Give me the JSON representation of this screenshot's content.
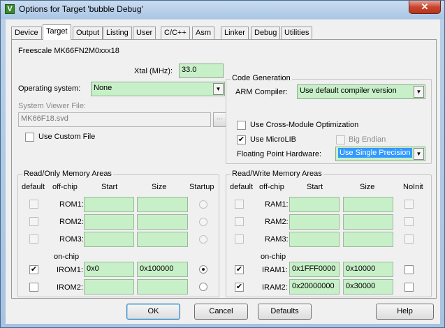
{
  "window": {
    "title": "Options for Target 'bubble Debug'",
    "icon_letter": "V",
    "close_glyph": "✕"
  },
  "tabs": [
    {
      "label": "Device"
    },
    {
      "label": "Target"
    },
    {
      "label": "Output"
    },
    {
      "label": "Listing"
    },
    {
      "label": "User"
    },
    {
      "label": "C/C++"
    },
    {
      "label": "Asm"
    },
    {
      "label": "Linker"
    },
    {
      "label": "Debug"
    },
    {
      "label": "Utilities"
    }
  ],
  "active_tab": "Target",
  "device_name": "Freescale MK66FN2M0xxx18",
  "xtal": {
    "label": "Xtal (MHz):",
    "value": "33.0"
  },
  "os": {
    "label": "Operating system:",
    "value": "None"
  },
  "svd": {
    "label": "System Viewer File:",
    "value": "MK66F18.svd",
    "browse_label": "...",
    "custom_label": "Use Custom File",
    "custom_checked": false
  },
  "code_gen": {
    "title": "Code Generation",
    "compiler_label": "ARM Compiler:",
    "compiler_value": "Use default compiler version",
    "cross_module_label": "Use Cross-Module Optimization",
    "cross_module_checked": false,
    "microlib_label": "Use MicroLIB",
    "microlib_checked": true,
    "big_endian_label": "Big Endian",
    "big_endian_checked": false,
    "fph_label": "Floating Point Hardware:",
    "fph_value": "Use Single Precision"
  },
  "ro_memory": {
    "title": "Read/Only Memory Areas",
    "headers": {
      "default": "default",
      "offchip": "off-chip",
      "start": "Start",
      "size": "Size",
      "startup": "Startup"
    },
    "onchip_label": "on-chip",
    "rows": [
      {
        "name": "ROM1:",
        "default": false,
        "start": "",
        "size": "",
        "startup": false
      },
      {
        "name": "ROM2:",
        "default": false,
        "start": "",
        "size": "",
        "startup": false
      },
      {
        "name": "ROM3:",
        "default": false,
        "start": "",
        "size": "",
        "startup": false
      },
      {
        "name": "IROM1:",
        "default": true,
        "start": "0x0",
        "size": "0x100000",
        "startup": true
      },
      {
        "name": "IROM2:",
        "default": false,
        "start": "",
        "size": "",
        "startup": false
      }
    ]
  },
  "rw_memory": {
    "title": "Read/Write Memory Areas",
    "headers": {
      "default": "default",
      "offchip": "off-chip",
      "start": "Start",
      "size": "Size",
      "noinit": "NoInit"
    },
    "onchip_label": "on-chip",
    "rows": [
      {
        "name": "RAM1:",
        "default": false,
        "start": "",
        "size": "",
        "noinit": false
      },
      {
        "name": "RAM2:",
        "default": false,
        "start": "",
        "size": "",
        "noinit": false
      },
      {
        "name": "RAM3:",
        "default": false,
        "start": "",
        "size": "",
        "noinit": false
      },
      {
        "name": "IRAM1:",
        "default": true,
        "start": "0x1FFF0000",
        "size": "0x10000",
        "noinit": false
      },
      {
        "name": "IRAM2:",
        "default": true,
        "start": "0x20000000",
        "size": "0x30000",
        "noinit": false
      }
    ]
  },
  "buttons": {
    "ok": "OK",
    "cancel": "Cancel",
    "defaults": "Defaults",
    "help": "Help"
  },
  "check_glyph": "✔",
  "dropdown_glyph": "▼",
  "colors": {
    "field_green": "#c8f0c8",
    "selection_blue": "#3399ff",
    "close_red": "#c9462e"
  }
}
